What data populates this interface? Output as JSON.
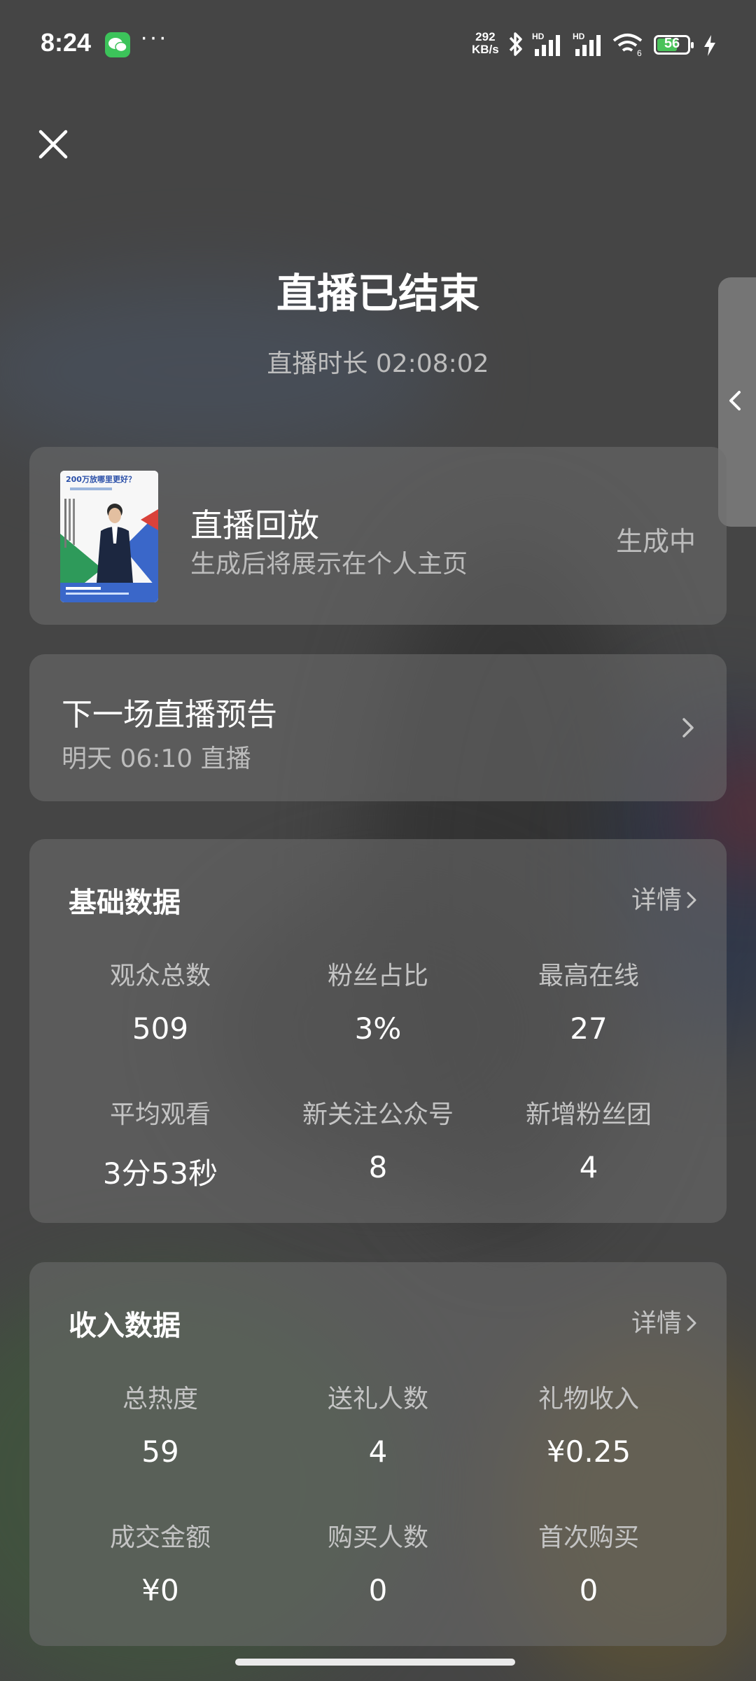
{
  "status_bar": {
    "time": "8:24",
    "more": "···",
    "net_speed_value": "292",
    "net_speed_unit": "KB/s",
    "sig1_label": "HD",
    "sig2_label": "HD",
    "wifi_label": "6",
    "battery_level": "56",
    "icons": [
      "wechat-icon",
      "bluetooth-icon",
      "signal-icon",
      "wifi-icon",
      "battery-icon",
      "charging-icon"
    ]
  },
  "header": {
    "title": "直播已结束",
    "duration": "直播时长 02:08:02"
  },
  "replay": {
    "title": "直播回放",
    "subtitle": "生成后将展示在个人主页",
    "status": "生成中",
    "thumbnail_text": "200万放哪里更好？"
  },
  "next_live": {
    "title": "下一场直播预告",
    "subtitle": "明天 06:10 直播"
  },
  "basic_data": {
    "title": "基础数据",
    "details": "详情",
    "stats": [
      {
        "label": "观众总数",
        "value": "509"
      },
      {
        "label": "粉丝占比",
        "value": "3%"
      },
      {
        "label": "最高在线",
        "value": "27"
      },
      {
        "label": "平均观看",
        "value": "3分53秒"
      },
      {
        "label": "新关注公众号",
        "value": "8"
      },
      {
        "label": "新增粉丝团",
        "value": "4"
      }
    ]
  },
  "income_data": {
    "title": "收入数据",
    "details": "详情",
    "stats": [
      {
        "label": "总热度",
        "value": "59"
      },
      {
        "label": "送礼人数",
        "value": "4"
      },
      {
        "label": "礼物收入",
        "value": "¥0.25"
      },
      {
        "label": "成交金额",
        "value": "¥0"
      },
      {
        "label": "购买人数",
        "value": "0"
      },
      {
        "label": "首次购买",
        "value": "0"
      }
    ]
  },
  "colors": {
    "background": "#454545",
    "card": "#6e6e6e",
    "muted_text": "#bdbdbd",
    "battery_fill": "#49c25a",
    "wechat_green": "#3cc35a"
  }
}
